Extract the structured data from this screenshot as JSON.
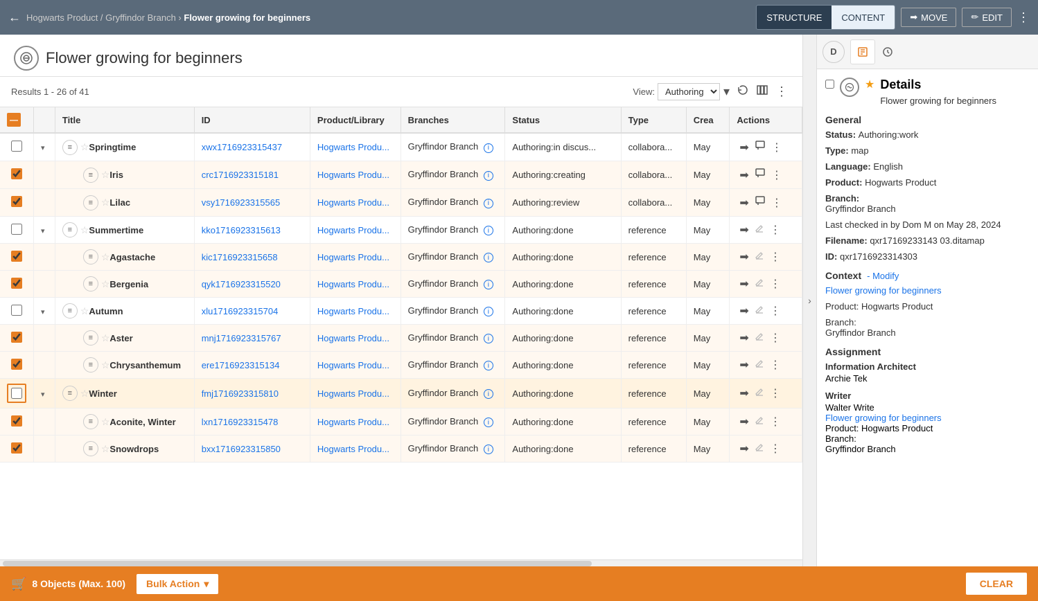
{
  "nav": {
    "back_label": "←",
    "breadcrumb": "Hogwarts Product / Gryffindor Branch",
    "separator": "›",
    "current_page": "Flower growing for beginners",
    "structure_label": "STRUCTURE",
    "content_label": "CONTENT",
    "move_label": "MOVE",
    "edit_label": "EDIT"
  },
  "page": {
    "title": "Flower growing for beginners",
    "results_text": "Results 1 - 26 of 41",
    "view_label": "View:",
    "view_option": "Authoring"
  },
  "table": {
    "columns": [
      "",
      "",
      "Title",
      "ID",
      "Product/Library",
      "Branches",
      "Status",
      "Type",
      "Crea",
      "Actions"
    ],
    "rows": [
      {
        "id": 1,
        "indent": 0,
        "expandable": true,
        "selected": false,
        "starred": false,
        "title": "Springtime",
        "item_id": "xwx1716923315437",
        "product": "Hogwarts Produ...",
        "branch": "Gryffindor Branch",
        "status": "Authoring:in discus...",
        "type": "collabora...",
        "created": "May",
        "has_arrow": true,
        "has_comment": true
      },
      {
        "id": 2,
        "indent": 1,
        "expandable": false,
        "selected": true,
        "starred": false,
        "title": "Iris",
        "item_id": "crc1716923315181",
        "product": "Hogwarts Produ...",
        "branch": "Gryffindor Branch",
        "status": "Authoring:creating",
        "type": "collabora...",
        "created": "May",
        "has_arrow": true,
        "has_comment": true
      },
      {
        "id": 3,
        "indent": 1,
        "expandable": false,
        "selected": true,
        "starred": false,
        "title": "Lilac",
        "item_id": "vsy1716923315565",
        "product": "Hogwarts Produ...",
        "branch": "Gryffindor Branch",
        "status": "Authoring:review",
        "type": "collabora...",
        "created": "May",
        "has_arrow": true,
        "has_comment": true
      },
      {
        "id": 4,
        "indent": 0,
        "expandable": true,
        "selected": false,
        "starred": false,
        "title": "Summertime",
        "item_id": "kko1716923315613",
        "product": "Hogwarts Produ...",
        "branch": "Gryffindor Branch",
        "status": "Authoring:done",
        "type": "reference",
        "created": "May",
        "has_arrow": true,
        "has_comment": false
      },
      {
        "id": 5,
        "indent": 1,
        "expandable": false,
        "selected": true,
        "starred": false,
        "title": "Agastache",
        "item_id": "kic1716923315658",
        "product": "Hogwarts Produ...",
        "branch": "Gryffindor Branch",
        "status": "Authoring:done",
        "type": "reference",
        "created": "May",
        "has_arrow": true,
        "has_comment": false
      },
      {
        "id": 6,
        "indent": 1,
        "expandable": false,
        "selected": true,
        "starred": false,
        "title": "Bergenia",
        "item_id": "qyk1716923315520",
        "product": "Hogwarts Produ...",
        "branch": "Gryffindor Branch",
        "status": "Authoring:done",
        "type": "reference",
        "created": "May",
        "has_arrow": true,
        "has_comment": false
      },
      {
        "id": 7,
        "indent": 0,
        "expandable": true,
        "selected": false,
        "starred": false,
        "title": "Autumn",
        "item_id": "xlu1716923315704",
        "product": "Hogwarts Produ...",
        "branch": "Gryffindor Branch",
        "status": "Authoring:done",
        "type": "reference",
        "created": "May",
        "has_arrow": true,
        "has_comment": false
      },
      {
        "id": 8,
        "indent": 1,
        "expandable": false,
        "selected": true,
        "starred": false,
        "title": "Aster",
        "item_id": "mnj1716923315767",
        "product": "Hogwarts Produ...",
        "branch": "Gryffindor Branch",
        "status": "Authoring:done",
        "type": "reference",
        "created": "May",
        "has_arrow": true,
        "has_comment": false
      },
      {
        "id": 9,
        "indent": 1,
        "expandable": false,
        "selected": true,
        "starred": false,
        "title": "Chrysanthemum",
        "item_id": "ere1716923315134",
        "product": "Hogwarts Produ...",
        "branch": "Gryffindor Branch",
        "status": "Authoring:done",
        "type": "reference",
        "created": "May",
        "has_arrow": true,
        "has_comment": false
      },
      {
        "id": 10,
        "indent": 0,
        "expandable": true,
        "selected": false,
        "starred": false,
        "highlighted": true,
        "title": "Winter",
        "item_id": "fmj1716923315810",
        "product": "Hogwarts Produ...",
        "branch": "Gryffindor Branch",
        "status": "Authoring:done",
        "type": "reference",
        "created": "May",
        "has_arrow": true,
        "has_comment": false
      },
      {
        "id": 11,
        "indent": 1,
        "expandable": false,
        "selected": true,
        "starred": false,
        "title": "Aconite, Winter",
        "item_id": "lxn1716923315478",
        "product": "Hogwarts Produ...",
        "branch": "Gryffindor Branch",
        "status": "Authoring:done",
        "type": "reference",
        "created": "May",
        "has_arrow": true,
        "has_comment": false
      },
      {
        "id": 12,
        "indent": 1,
        "expandable": false,
        "selected": true,
        "starred": false,
        "title": "Snowdrops",
        "item_id": "bxx1716923315850",
        "product": "Hogwarts Produ...",
        "branch": "Gryffindor Branch",
        "status": "Authoring:done",
        "type": "reference",
        "created": "May",
        "has_arrow": true,
        "has_comment": false
      }
    ]
  },
  "sidebar": {
    "title": "Details",
    "d_label": "D",
    "general_title": "General",
    "status": "Authoring:work",
    "type": "map",
    "language": "English",
    "product": "Hogwarts Product",
    "branch_label": "Branch:",
    "branch_value": "Gryffindor Branch",
    "last_checked": "Last checked in by Dom M on May 28, 2024",
    "filename_label": "Filename:",
    "filename_value": "qxr17169233143 03.ditamap",
    "id_label": "ID:",
    "id_value": "qxr1716923314303",
    "context_title": "Context",
    "context_modify": "- Modify",
    "context_link": "Flower growing for beginners",
    "context_product": "Product: Hogwarts Product",
    "context_branch_label": "Branch:",
    "context_branch_value": "Gryffindor Branch",
    "assignment_title": "Assignment",
    "ia_title": "Information Architect",
    "ia_name": "Archie Tek",
    "writer_title": "Writer",
    "writer_name": "Walter Write",
    "writer_link": "Flower growing for beginners",
    "writer_product": "Product: Hogwarts Product",
    "writer_branch_label": "Branch:",
    "writer_branch_value": "Gryffindor Branch"
  },
  "bottom_bar": {
    "objects_count": "8 Objects (Max. 100)",
    "bulk_action_label": "Bulk Action",
    "clear_label": "CLEAR"
  }
}
